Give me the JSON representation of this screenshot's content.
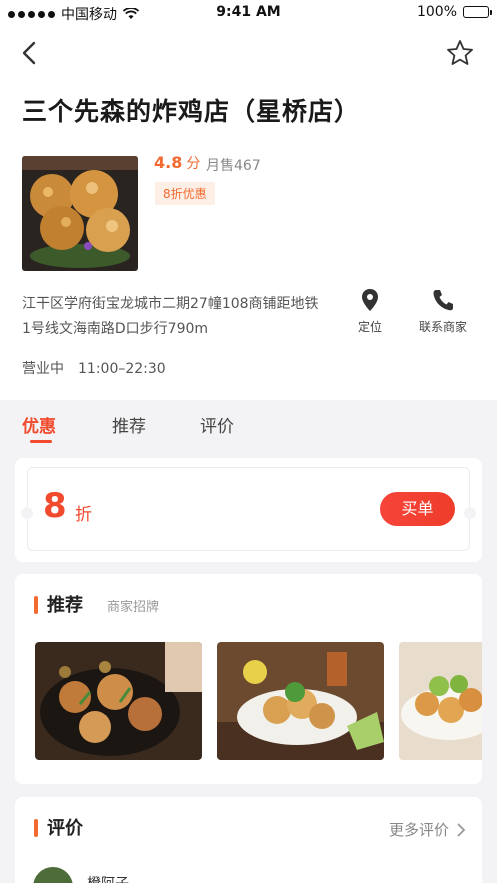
{
  "status_bar": {
    "carrier": "中国移动",
    "time": "9:41 AM",
    "battery": "100%"
  },
  "icons": {
    "back": "chevron-left-icon",
    "favorite": "star-outline-icon",
    "locate": "map-pin-icon",
    "contact": "phone-icon",
    "more": "chevron-right-icon"
  },
  "shop": {
    "name": "三个先森的炸鸡店（星桥店）",
    "rating_value": "4.8",
    "rating_unit": "分",
    "monthly_sales": "月售467",
    "discount_tag": "8折优惠",
    "address": "江干区学府街宝龙城市二期27幢108商铺距地铁1号线文海南路D口步行790m",
    "locate_label": "定位",
    "contact_label": "联系商家",
    "status": "营业中",
    "hours": "11:00–22:30"
  },
  "tabs": [
    {
      "label": "优惠",
      "active": true
    },
    {
      "label": "推荐",
      "active": false
    },
    {
      "label": "评价",
      "active": false
    }
  ],
  "discount_card": {
    "value": "8",
    "unit": "折",
    "buy_label": "买单"
  },
  "recommend": {
    "title": "推荐",
    "subtitle": "商家招牌"
  },
  "reviews": {
    "title": "评价",
    "more_label": "更多评价",
    "first_reviewer": "橙阿子"
  },
  "colors": {
    "accent": "#f24a2c",
    "orange": "#f26a30",
    "tag_bg": "#fdeee6",
    "page_bg": "#f3f3f5"
  }
}
